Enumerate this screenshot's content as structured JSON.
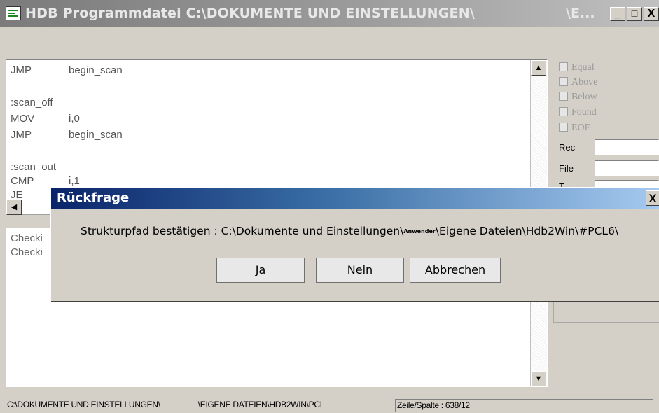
{
  "window": {
    "title": "HDB Programmdatei C:\\DOKUMENTE UND EINSTELLUNGEN\\",
    "title_tail": "\\E...",
    "minimize": "_",
    "maximize": "□",
    "close": "X"
  },
  "editor": {
    "lines": [
      {
        "op": "JMP",
        "arg": "begin_scan"
      },
      {
        "op": "",
        "arg": ""
      },
      {
        "op": ":scan_off",
        "arg": ""
      },
      {
        "op": "MOV",
        "arg": "i,0"
      },
      {
        "op": "JMP",
        "arg": "begin_scan"
      },
      {
        "op": "",
        "arg": ""
      },
      {
        "op": ":scan_out",
        "arg": ""
      },
      {
        "op": "CMP",
        "arg": "i,1"
      },
      {
        "op": "JE",
        "arg": ""
      }
    ],
    "scroll_up": "▲",
    "scroll_down": "▼",
    "scroll_left": "◀"
  },
  "output": {
    "lines": [
      "Checki",
      "Checki"
    ]
  },
  "flags": [
    "Equal",
    "Above",
    "Below",
    "Found",
    "EOF"
  ],
  "fields": {
    "rec_label": "Rec",
    "file_label": "File",
    "third_label": "T"
  },
  "status": {
    "path1": "C:\\DOKUMENTE UND EINSTELLUNGEN\\",
    "path2": "\\EIGENE DATEIEN\\HDB2WIN\\PCL",
    "position": "Zeile/Spalte : 638/12"
  },
  "dialog": {
    "title": "Rückfrage",
    "close": "X",
    "message_part1": "Strukturpfad bestätigen : C:\\Dokumente und Einstellungen\\",
    "message_tiny": "Anwender",
    "message_part2": "\\Eigene Dateien\\Hdb2Win\\#PCL6\\",
    "buttons": {
      "yes": "Ja",
      "no": "Nein",
      "cancel": "Abbrechen"
    }
  }
}
